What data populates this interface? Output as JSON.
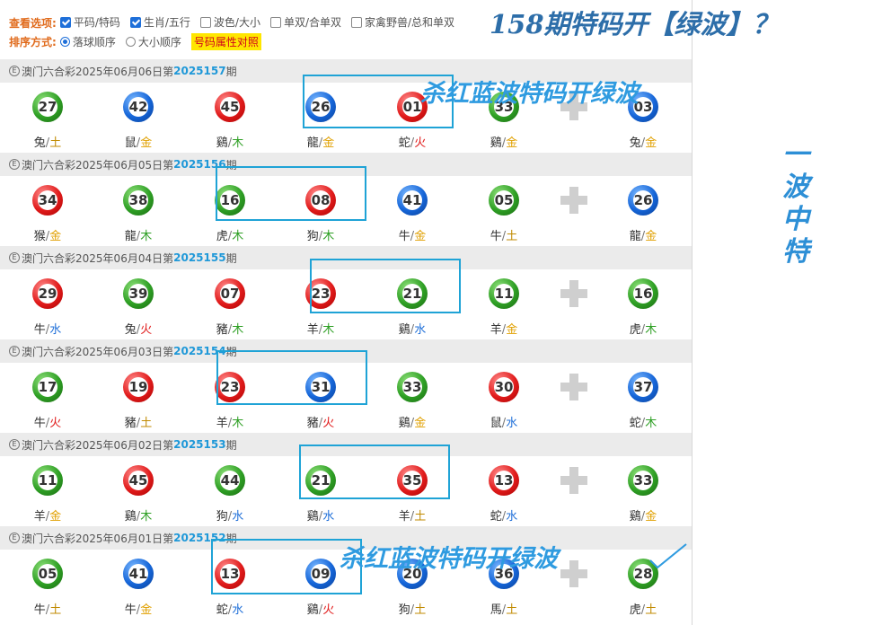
{
  "options": {
    "view_label": "查看选项:",
    "view_options": [
      {
        "label": "平码/特码",
        "checked": true
      },
      {
        "label": "生肖/五行",
        "checked": true
      },
      {
        "label": "波色/大小",
        "checked": false
      },
      {
        "label": "单双/合单双",
        "checked": false
      },
      {
        "label": "家禽野兽/总和单双",
        "checked": false
      }
    ],
    "sort_label": "排序方式:",
    "sort_options": [
      {
        "label": "落球顺序",
        "selected": true
      },
      {
        "label": "大小顺序",
        "selected": false
      }
    ],
    "attr_button": "号码属性对照"
  },
  "colors": {
    "red": "#e11b1b",
    "blue": "#1565d8",
    "green": "#2e9f24",
    "highlight": "#1fa3d6",
    "accent": "#1f98d8"
  },
  "draws": [
    {
      "lottery": "澳门六合彩",
      "date": "2025年06月06日",
      "issue_prefix": "第",
      "issue": "2025157",
      "issue_suffix": "期",
      "balls": [
        {
          "num": "27",
          "color": "green",
          "zodiac": "兔",
          "element": "土"
        },
        {
          "num": "42",
          "color": "blue",
          "zodiac": "鼠",
          "element": "金"
        },
        {
          "num": "45",
          "color": "red",
          "zodiac": "鷄",
          "element": "木"
        },
        {
          "num": "26",
          "color": "blue",
          "zodiac": "龍",
          "element": "金"
        },
        {
          "num": "01",
          "color": "red",
          "zodiac": "蛇",
          "element": "火"
        },
        {
          "num": "33",
          "color": "green",
          "zodiac": "鷄",
          "element": "金"
        },
        {
          "num": "03",
          "color": "blue",
          "zodiac": "兔",
          "element": "金"
        }
      ]
    },
    {
      "lottery": "澳门六合彩",
      "date": "2025年06月05日",
      "issue_prefix": "第",
      "issue": "2025156",
      "issue_suffix": "期",
      "balls": [
        {
          "num": "34",
          "color": "red",
          "zodiac": "猴",
          "element": "金"
        },
        {
          "num": "38",
          "color": "green",
          "zodiac": "龍",
          "element": "木"
        },
        {
          "num": "16",
          "color": "green",
          "zodiac": "虎",
          "element": "木"
        },
        {
          "num": "08",
          "color": "red",
          "zodiac": "狗",
          "element": "木"
        },
        {
          "num": "41",
          "color": "blue",
          "zodiac": "牛",
          "element": "金"
        },
        {
          "num": "05",
          "color": "green",
          "zodiac": "牛",
          "element": "土"
        },
        {
          "num": "26",
          "color": "blue",
          "zodiac": "龍",
          "element": "金"
        }
      ]
    },
    {
      "lottery": "澳门六合彩",
      "date": "2025年06月04日",
      "issue_prefix": "第",
      "issue": "2025155",
      "issue_suffix": "期",
      "balls": [
        {
          "num": "29",
          "color": "red",
          "zodiac": "牛",
          "element": "水"
        },
        {
          "num": "39",
          "color": "green",
          "zodiac": "兔",
          "element": "火"
        },
        {
          "num": "07",
          "color": "red",
          "zodiac": "豬",
          "element": "木"
        },
        {
          "num": "23",
          "color": "red",
          "zodiac": "羊",
          "element": "木"
        },
        {
          "num": "21",
          "color": "green",
          "zodiac": "鷄",
          "element": "水"
        },
        {
          "num": "11",
          "color": "green",
          "zodiac": "羊",
          "element": "金"
        },
        {
          "num": "16",
          "color": "green",
          "zodiac": "虎",
          "element": "木"
        }
      ]
    },
    {
      "lottery": "澳门六合彩",
      "date": "2025年06月03日",
      "issue_prefix": "第",
      "issue": "2025154",
      "issue_suffix": "期",
      "balls": [
        {
          "num": "17",
          "color": "green",
          "zodiac": "牛",
          "element": "火"
        },
        {
          "num": "19",
          "color": "red",
          "zodiac": "豬",
          "element": "土"
        },
        {
          "num": "23",
          "color": "red",
          "zodiac": "羊",
          "element": "木"
        },
        {
          "num": "31",
          "color": "blue",
          "zodiac": "豬",
          "element": "火"
        },
        {
          "num": "33",
          "color": "green",
          "zodiac": "鷄",
          "element": "金"
        },
        {
          "num": "30",
          "color": "red",
          "zodiac": "鼠",
          "element": "水"
        },
        {
          "num": "37",
          "color": "blue",
          "zodiac": "蛇",
          "element": "木"
        }
      ]
    },
    {
      "lottery": "澳门六合彩",
      "date": "2025年06月02日",
      "issue_prefix": "第",
      "issue": "2025153",
      "issue_suffix": "期",
      "balls": [
        {
          "num": "11",
          "color": "green",
          "zodiac": "羊",
          "element": "金"
        },
        {
          "num": "45",
          "color": "red",
          "zodiac": "鷄",
          "element": "木"
        },
        {
          "num": "44",
          "color": "green",
          "zodiac": "狗",
          "element": "水"
        },
        {
          "num": "21",
          "color": "green",
          "zodiac": "鷄",
          "element": "水"
        },
        {
          "num": "35",
          "color": "red",
          "zodiac": "羊",
          "element": "土"
        },
        {
          "num": "13",
          "color": "red",
          "zodiac": "蛇",
          "element": "水"
        },
        {
          "num": "33",
          "color": "green",
          "zodiac": "鷄",
          "element": "金"
        }
      ]
    },
    {
      "lottery": "澳门六合彩",
      "date": "2025年06月01日",
      "issue_prefix": "第",
      "issue": "2025152",
      "issue_suffix": "期",
      "balls": [
        {
          "num": "05",
          "color": "green",
          "zodiac": "牛",
          "element": "土"
        },
        {
          "num": "41",
          "color": "blue",
          "zodiac": "牛",
          "element": "金"
        },
        {
          "num": "13",
          "color": "red",
          "zodiac": "蛇",
          "element": "水"
        },
        {
          "num": "09",
          "color": "blue",
          "zodiac": "鷄",
          "element": "火"
        },
        {
          "num": "20",
          "color": "blue",
          "zodiac": "狗",
          "element": "土"
        },
        {
          "num": "36",
          "color": "blue",
          "zodiac": "馬",
          "element": "土"
        },
        {
          "num": "28",
          "color": "green",
          "zodiac": "虎",
          "element": "土"
        }
      ]
    }
  ],
  "annotations": {
    "top": "158期特码开【绿波】？",
    "mid": "杀红蓝波特码开绿波",
    "bottom": "杀红蓝波特码开绿波",
    "vertical": [
      "一",
      "波",
      "中",
      "特"
    ]
  }
}
